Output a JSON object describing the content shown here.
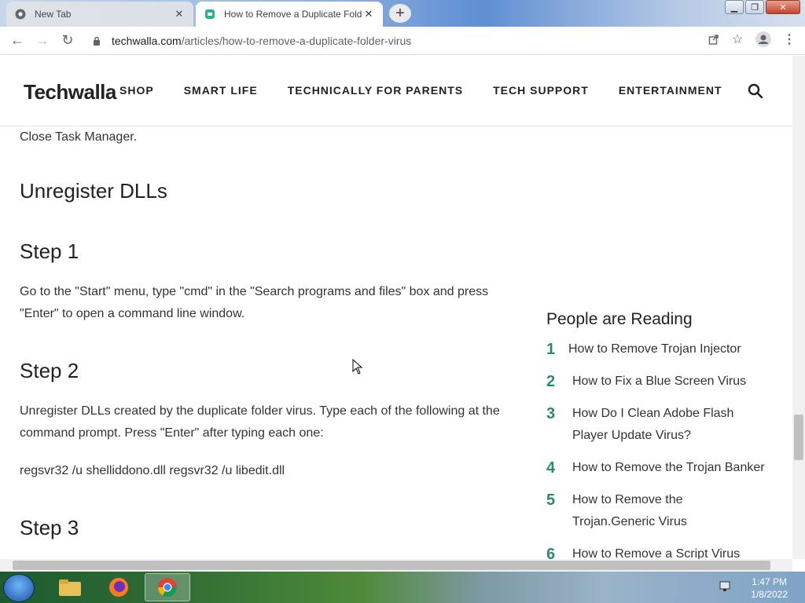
{
  "browser": {
    "tabs": [
      {
        "title": "New Tab",
        "icon": "chrome-icon"
      },
      {
        "title": "How to Remove a Duplicate Folder Virus",
        "icon": "techwalla-favicon"
      }
    ],
    "url_host": "techwalla.com",
    "url_path": "/articles/how-to-remove-a-duplicate-folder-virus"
  },
  "site": {
    "logo": "Techwalla",
    "nav": [
      "SHOP",
      "SMART LIFE",
      "TECHNICALLY FOR PARENTS",
      "TECH SUPPORT",
      "ENTERTAINMENT"
    ]
  },
  "article": {
    "close_text": "Close Task Manager.",
    "heading": "Unregister DLLs",
    "step1_title": "Step 1",
    "step1_text": "Go to the \"Start\" menu, type \"cmd\" in the \"Search programs and files\" box and press \"Enter\" to open a command line window.",
    "step2_title": "Step 2",
    "step2_text": "Unregister DLLs created by the duplicate folder virus. Type each of the following at the command prompt. Press \"Enter\" after typing each one:",
    "command": "regsvr32 /u shelliddono.dll regsvr32 /u libedit.dll",
    "step3_title": "Step 3"
  },
  "sidebar": {
    "title": "People are Reading",
    "items": [
      {
        "num": "1",
        "text": "How to Remove Trojan Injector"
      },
      {
        "num": "2",
        "text": "How to Fix a Blue Screen Virus"
      },
      {
        "num": "3",
        "text": "How Do I Clean Adobe Flash Player Update Virus?"
      },
      {
        "num": "4",
        "text": "How to Remove the Trojan Banker"
      },
      {
        "num": "5",
        "text": "How to Remove the Trojan.Generic Virus"
      },
      {
        "num": "6",
        "text": "How to Remove a Script Virus"
      }
    ]
  },
  "taskbar": {
    "time": "1:47 PM",
    "date": "1/8/2022"
  },
  "colors": {
    "accent_green": "#2b8a6e"
  }
}
